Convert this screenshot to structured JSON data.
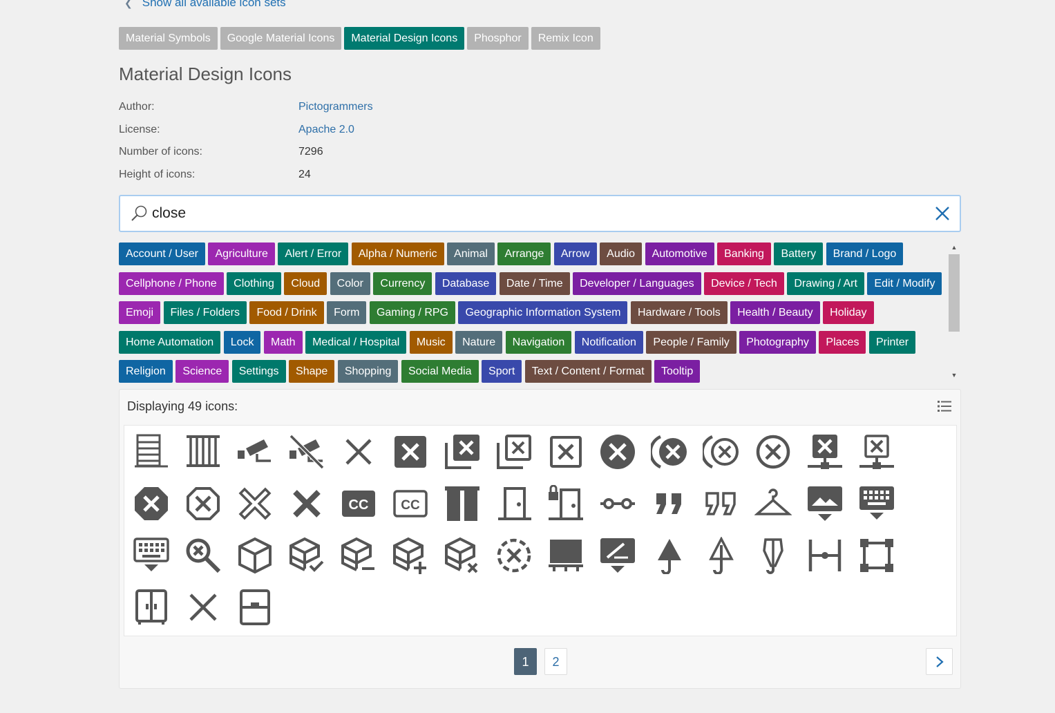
{
  "nav": {
    "back_label": "Show all available icon sets"
  },
  "tabs": [
    {
      "label": "Material Symbols",
      "active": false
    },
    {
      "label": "Google Material Icons",
      "active": false
    },
    {
      "label": "Material Design Icons",
      "active": true
    },
    {
      "label": "Phosphor",
      "active": false
    },
    {
      "label": "Remix Icon",
      "active": false
    }
  ],
  "title": "Material Design Icons",
  "info": {
    "author_label": "Author:",
    "author_value": "Pictogrammers",
    "license_label": "License:",
    "license_value": "Apache 2.0",
    "count_label": "Number of icons:",
    "count_value": "7296",
    "height_label": "Height of icons:",
    "height_value": "24"
  },
  "search": {
    "value": "close",
    "placeholder": ""
  },
  "categories": [
    {
      "label": "Account / User",
      "color": "#1066a3"
    },
    {
      "label": "Agriculture",
      "color": "#9c27b0"
    },
    {
      "label": "Alert / Error",
      "color": "#00796b"
    },
    {
      "label": "Alpha / Numeric",
      "color": "#a15a00"
    },
    {
      "label": "Animal",
      "color": "#546e7a"
    },
    {
      "label": "Arrange",
      "color": "#2e7d32"
    },
    {
      "label": "Arrow",
      "color": "#3949ab"
    },
    {
      "label": "Audio",
      "color": "#6d4c41"
    },
    {
      "label": "Automotive",
      "color": "#7b1fa2"
    },
    {
      "label": "Banking",
      "color": "#c2185b"
    },
    {
      "label": "Battery",
      "color": "#00796b"
    },
    {
      "label": "Brand / Logo",
      "color": "#1066a3"
    },
    {
      "label": "Cellphone / Phone",
      "color": "#9c27b0"
    },
    {
      "label": "Clothing",
      "color": "#00796b"
    },
    {
      "label": "Cloud",
      "color": "#a15a00"
    },
    {
      "label": "Color",
      "color": "#546e7a"
    },
    {
      "label": "Currency",
      "color": "#2e7d32"
    },
    {
      "label": "Database",
      "color": "#3949ab"
    },
    {
      "label": "Date / Time",
      "color": "#6d4c41"
    },
    {
      "label": "Developer / Languages",
      "color": "#7b1fa2"
    },
    {
      "label": "Device / Tech",
      "color": "#c2185b"
    },
    {
      "label": "Drawing / Art",
      "color": "#00796b"
    },
    {
      "label": "Edit / Modify",
      "color": "#1066a3"
    },
    {
      "label": "Emoji",
      "color": "#9c27b0"
    },
    {
      "label": "Files / Folders",
      "color": "#00796b"
    },
    {
      "label": "Food / Drink",
      "color": "#a15a00"
    },
    {
      "label": "Form",
      "color": "#546e7a"
    },
    {
      "label": "Gaming / RPG",
      "color": "#2e7d32"
    },
    {
      "label": "Geographic Information System",
      "color": "#3949ab"
    },
    {
      "label": "Hardware / Tools",
      "color": "#6d4c41"
    },
    {
      "label": "Health / Beauty",
      "color": "#7b1fa2"
    },
    {
      "label": "Holiday",
      "color": "#c2185b"
    },
    {
      "label": "Home Automation",
      "color": "#00796b"
    },
    {
      "label": "Lock",
      "color": "#1066a3"
    },
    {
      "label": "Math",
      "color": "#9c27b0"
    },
    {
      "label": "Medical / Hospital",
      "color": "#00796b"
    },
    {
      "label": "Music",
      "color": "#a15a00"
    },
    {
      "label": "Nature",
      "color": "#546e7a"
    },
    {
      "label": "Navigation",
      "color": "#2e7d32"
    },
    {
      "label": "Notification",
      "color": "#3949ab"
    },
    {
      "label": "People / Family",
      "color": "#6d4c41"
    },
    {
      "label": "Photography",
      "color": "#7b1fa2"
    },
    {
      "label": "Places",
      "color": "#c2185b"
    },
    {
      "label": "Printer",
      "color": "#00796b"
    },
    {
      "label": "Religion",
      "color": "#1066a3"
    },
    {
      "label": "Science",
      "color": "#9c27b0"
    },
    {
      "label": "Settings",
      "color": "#00796b"
    },
    {
      "label": "Shape",
      "color": "#a15a00"
    },
    {
      "label": "Shopping",
      "color": "#546e7a"
    },
    {
      "label": "Social Media",
      "color": "#2e7d32"
    },
    {
      "label": "Sport",
      "color": "#3949ab"
    },
    {
      "label": "Text / Content / Format",
      "color": "#6d4c41"
    },
    {
      "label": "Tooltip",
      "color": "#7b1fa2"
    }
  ],
  "results": {
    "heading": "Displaying 49 icons:"
  },
  "icons": [
    "blinds-close-icon",
    "blinds-horizontal-closed-icon",
    "cctv-icon",
    "cctv-off-icon",
    "close-icon",
    "close-box-icon",
    "close-box-multiple-icon",
    "close-box-multiple-outline-icon",
    "close-box-outline-icon",
    "close-circle-icon",
    "close-circle-multiple-icon",
    "close-circle-multiple-outline-icon",
    "close-circle-outline-icon",
    "close-network-icon",
    "close-network-outline-icon",
    "close-octagon-icon",
    "close-octagon-outline-icon",
    "close-outline-icon",
    "close-thick-icon",
    "closed-caption-icon",
    "closed-caption-outline-icon",
    "curtains-closed-icon",
    "door-closed-icon",
    "door-closed-lock-icon",
    "electric-switch-closed-icon",
    "format-quote-close-icon",
    "format-quote-close-outline-icon",
    "hanger-icon",
    "image-filter-center-focus-icon",
    "keyboard-close-icon",
    "keyboard-close-outline-icon",
    "magnify-close-icon",
    "package-variant-closed-icon",
    "package-variant-closed-check-icon",
    "package-variant-closed-minus-icon",
    "package-variant-closed-plus-icon",
    "package-variant-closed-remove-icon",
    "progress-close-icon",
    "projector-screen-icon",
    "selection-ellipse-close-icon",
    "umbrella-closed-icon",
    "umbrella-closed-outline-icon",
    "umbrella-closed-variant-icon",
    "vector-point-edit-icon",
    "vector-square-close-icon",
    "wardrobe-icon",
    "window-close-icon",
    "window-shutter-icon"
  ],
  "pagination": {
    "pages": [
      "1",
      "2"
    ],
    "current": "1"
  }
}
